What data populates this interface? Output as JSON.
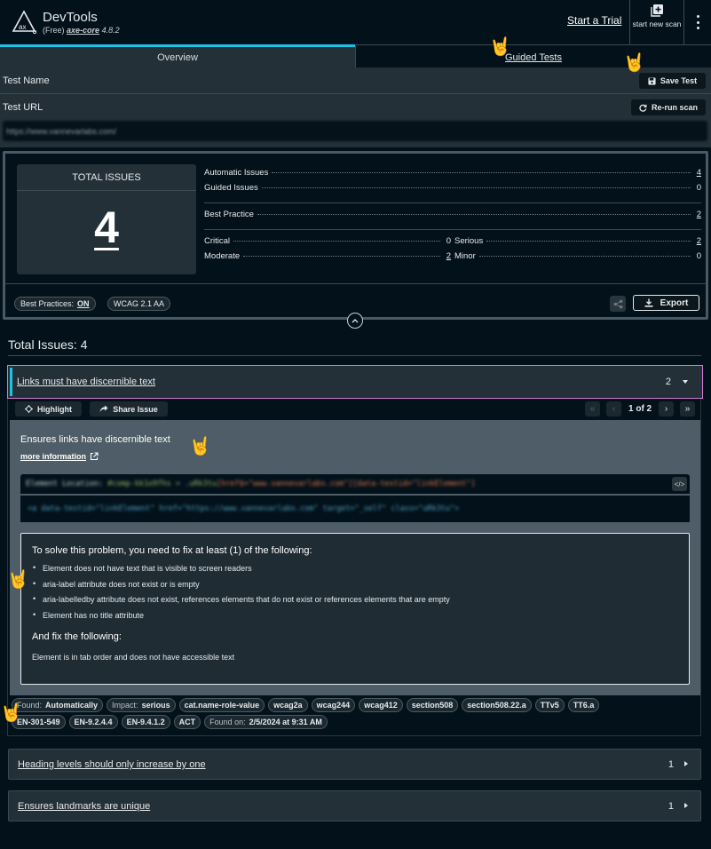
{
  "header": {
    "app_title": "DevTools",
    "edition": "(Free)",
    "engine": "axe-core",
    "version": "4.8.2",
    "trial_link": "Start a Trial",
    "new_scan_label": "start new scan",
    "more_menu_icon": "kebab-vertical-icon"
  },
  "tabs": [
    {
      "label": "Overview",
      "active": true
    },
    {
      "label": "Guided Tests",
      "active": false
    }
  ],
  "test_info": {
    "name_label": "Test Name",
    "save_button": "Save Test",
    "url_label": "Test URL",
    "rerun_button": "Re-run scan",
    "url_value": "https://www.vannevarlabs.com/"
  },
  "summary": {
    "total_title": "TOTAL ISSUES",
    "total_count": "4",
    "automatic_label": "Automatic Issues",
    "automatic_value": "4",
    "guided_label": "Guided Issues",
    "guided_value": "0",
    "best_practice_label": "Best Practice",
    "best_practice_value": "2",
    "critical_label": "Critical",
    "critical_value": "0",
    "serious_label": "Serious",
    "serious_value": "2",
    "moderate_label": "Moderate",
    "moderate_value": "2",
    "minor_label": "Minor",
    "minor_value": "0",
    "best_practices_pill_label": "Best Practices:",
    "best_practices_pill_value": "ON",
    "standard_pill": "WCAG 2.1 AA",
    "export_button": "Export"
  },
  "issues_header": "Total Issues: 4",
  "issues": [
    {
      "title": "Links must have discernible text",
      "count": "2",
      "expanded": true,
      "highlight_button": "Highlight",
      "share_button": "Share Issue",
      "pagination": "1 of 2",
      "description": "Ensures links have discernible text",
      "more_info": "more information",
      "element_location_label": "Element Location:",
      "element_location_selector": "#comp-kk1o9fhs > .uRk3tu",
      "element_location_attrs": "[href$=\"www.vannevarlabs.com\"][data-testid=\"linkElement\"]",
      "snippet_tag": "<a data-testid=\"linkElement\" href=\"https://www.vannevarlabs.com\" target=\"_self\" class=\"uRk3tu\">",
      "fix_any_heading": "To solve this problem, you need to fix at least (1) of the following:",
      "fix_any_items": [
        "Element does not have text that is visible to screen readers",
        "aria-label attribute does not exist or is empty",
        "aria-labelledby attribute does not exist, references elements that do not exist or references elements that are empty",
        "Element has no title attribute"
      ],
      "fix_all_heading": "And fix the following:",
      "fix_all_items": [
        "Element is in tab order and does not have accessible text"
      ],
      "tags_row1": [
        {
          "key": "Found:",
          "value": "Automatically"
        },
        {
          "key": "Impact:",
          "value": "serious"
        },
        {
          "key": "",
          "value": "cat.name-role-value"
        },
        {
          "key": "",
          "value": "wcag2a"
        },
        {
          "key": "",
          "value": "wcag244"
        },
        {
          "key": "",
          "value": "wcag412"
        },
        {
          "key": "",
          "value": "section508"
        },
        {
          "key": "",
          "value": "section508.22.a"
        },
        {
          "key": "",
          "value": "TTv5"
        },
        {
          "key": "",
          "value": "TT6.a"
        }
      ],
      "tags_row2": [
        {
          "key": "",
          "value": "EN-301-549"
        },
        {
          "key": "",
          "value": "EN-9.2.4.4"
        },
        {
          "key": "",
          "value": "EN-9.4.1.2"
        },
        {
          "key": "",
          "value": "ACT"
        },
        {
          "key": "Found on:",
          "value": "2/5/2024 at 9:31 AM"
        }
      ]
    },
    {
      "title": "Heading levels should only increase by one",
      "count": "1",
      "expanded": false
    },
    {
      "title": "Ensures landmarks are unique",
      "count": "1",
      "expanded": false
    }
  ],
  "overlay_emoji": "🤘"
}
